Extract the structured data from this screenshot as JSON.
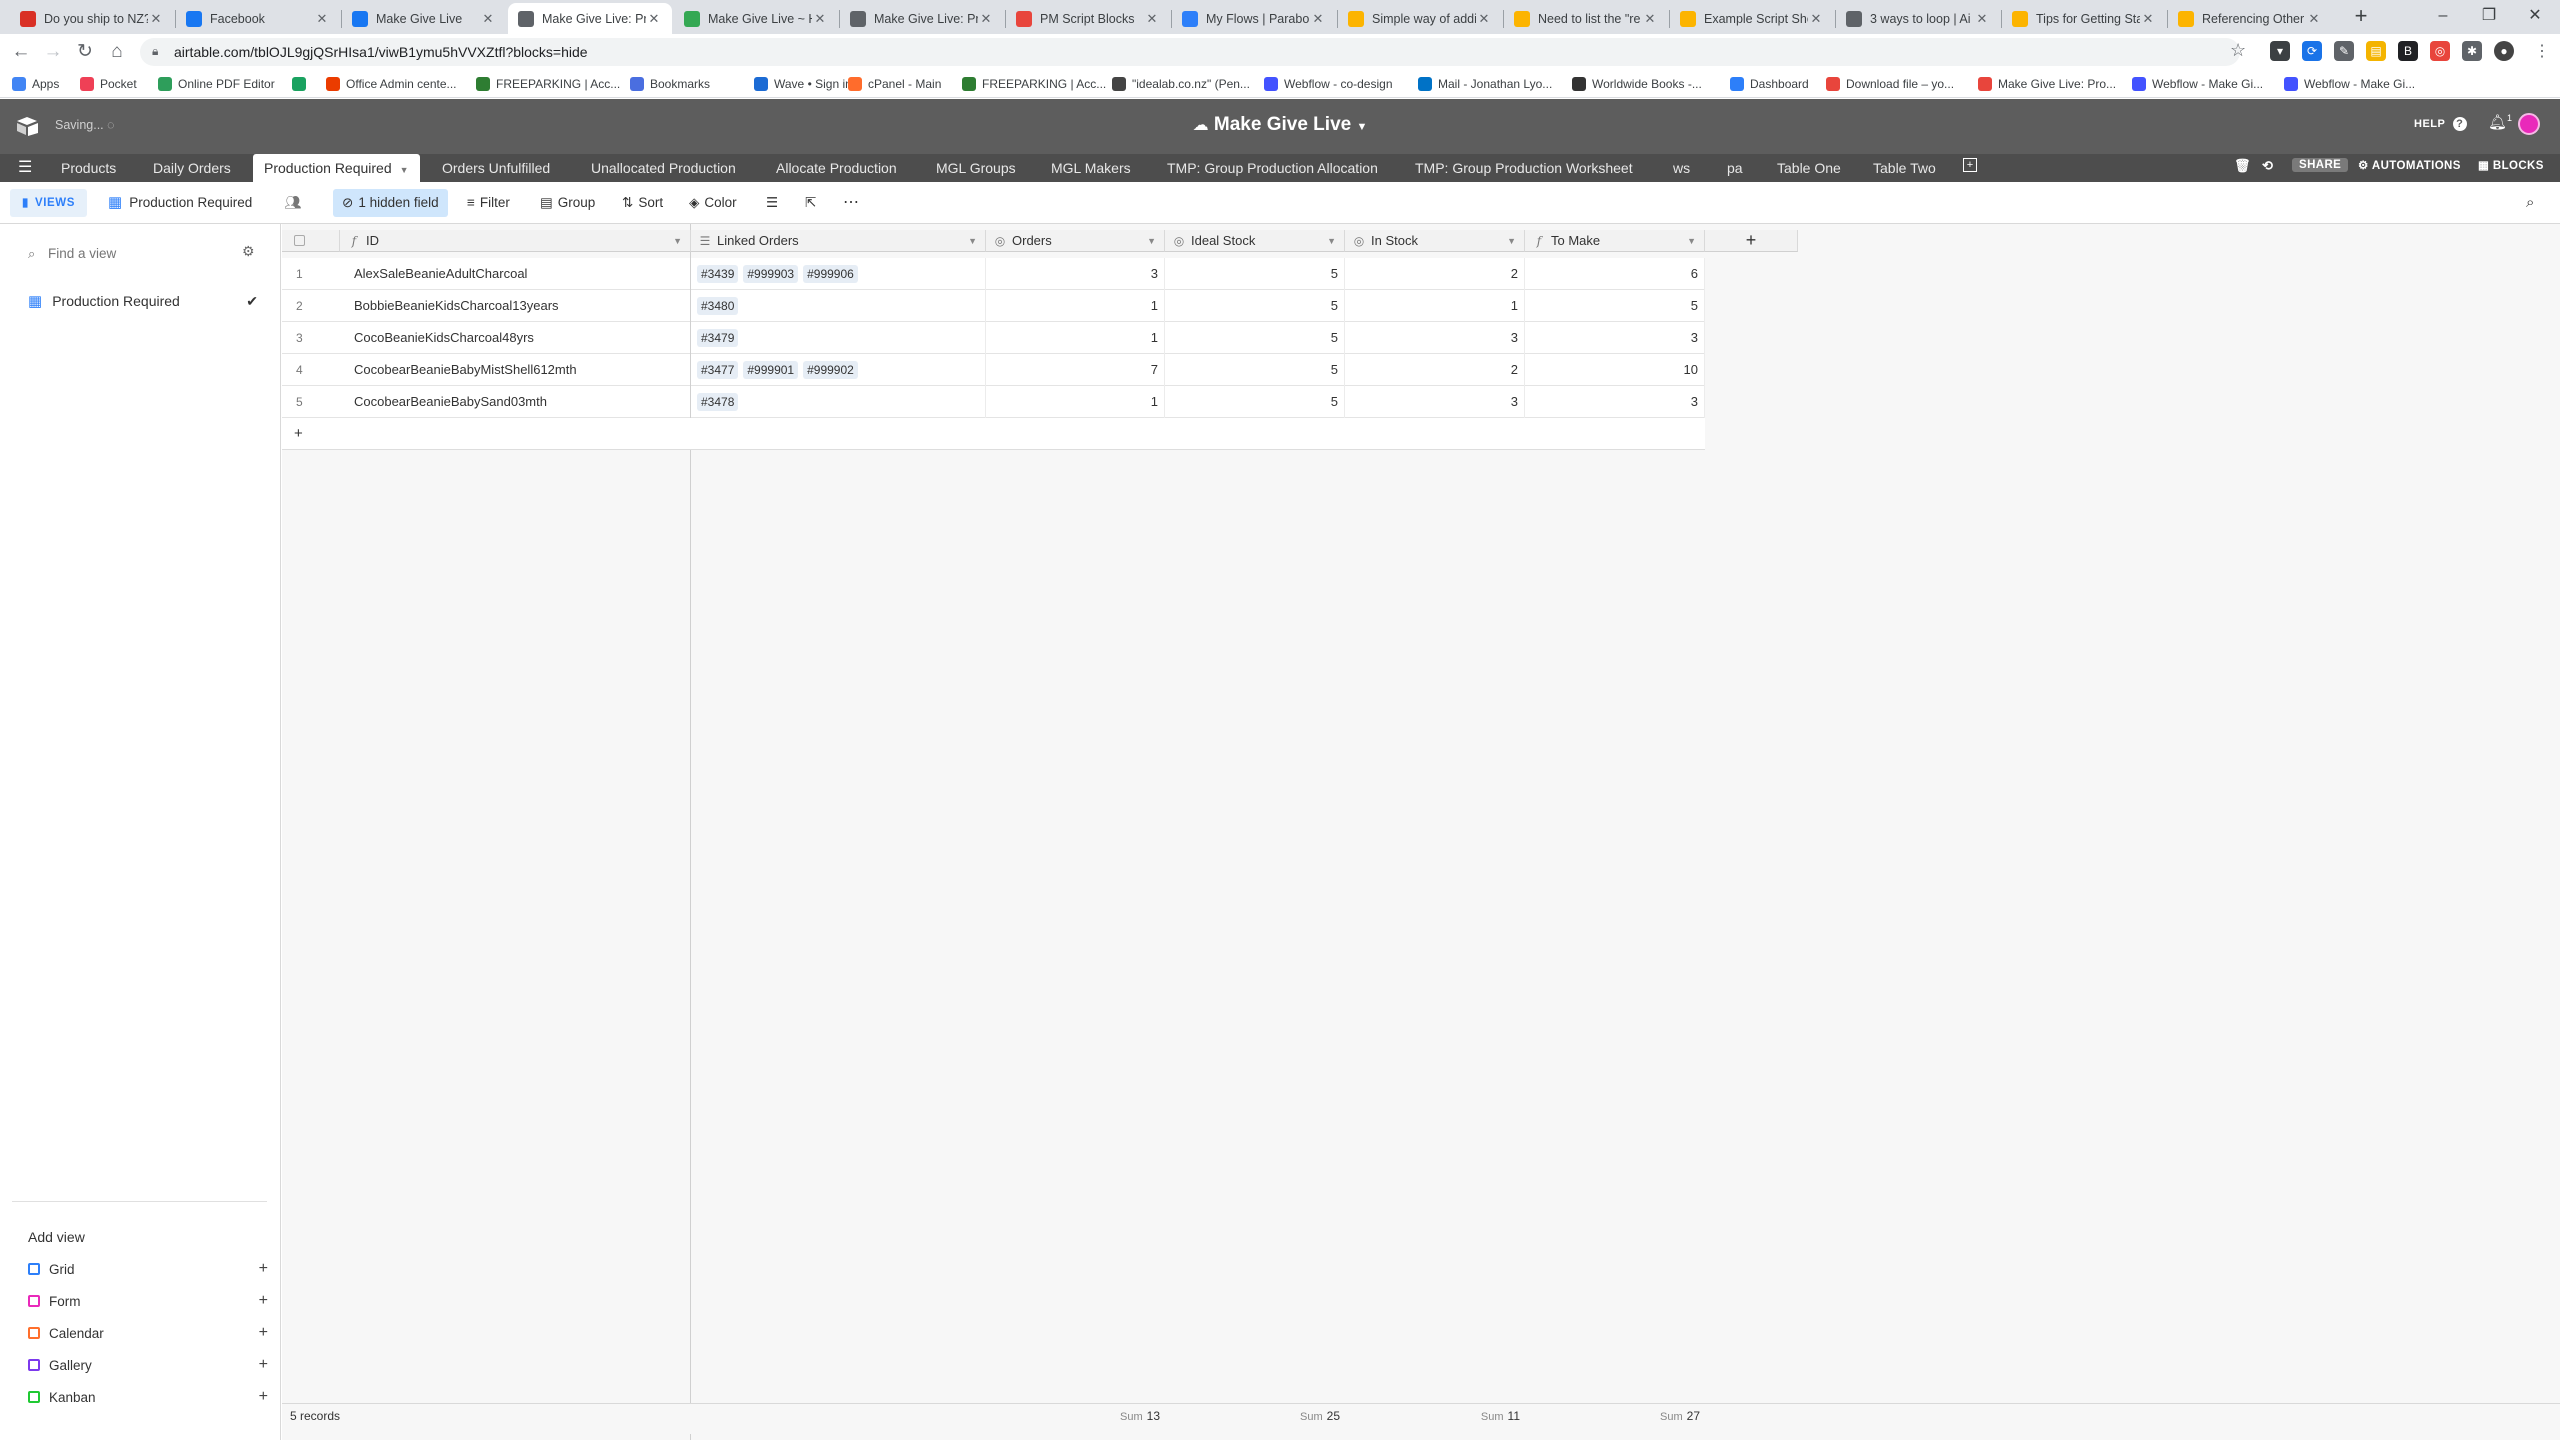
{
  "browser": {
    "tabs": [
      {
        "title": "Do you ship to NZ?",
        "favicon_color": "#d93025",
        "active": false
      },
      {
        "title": "Facebook",
        "favicon_color": "#1877f2",
        "active": false
      },
      {
        "title": "Make Give Live",
        "favicon_color": "#1877f2",
        "active": false
      },
      {
        "title": "Make Give Live: Production Required",
        "favicon_color": "#5f6368",
        "active": true
      },
      {
        "title": "Make Give Live ~ Home",
        "favicon_color": "#34a853",
        "active": false
      },
      {
        "title": "Make Give Live: Production",
        "favicon_color": "#5f6368",
        "active": false
      },
      {
        "title": "PM Script Blocks",
        "favicon_color": "#e8453c",
        "active": false
      },
      {
        "title": "My Flows | Parabola",
        "favicon_color": "#2d7ff9",
        "active": false
      },
      {
        "title": "Simple way of adding",
        "favicon_color": "#fcb400",
        "active": false
      },
      {
        "title": "Need to list the \"re",
        "favicon_color": "#fcb400",
        "active": false
      },
      {
        "title": "Example Script Sho",
        "favicon_color": "#fcb400",
        "active": false
      },
      {
        "title": "3 ways to loop | Ai",
        "favicon_color": "#5f6368",
        "active": false
      },
      {
        "title": "Tips for Getting Sta",
        "favicon_color": "#fcb400",
        "active": false
      },
      {
        "title": "Referencing Other",
        "favicon_color": "#fcb400",
        "active": false
      }
    ],
    "url": "airtable.com/tblOJL9gjQSrHIsa1/viwB1ymu5hVVXZtfl?blocks=hide",
    "bookmarks": [
      {
        "label": "Apps",
        "color": "#4285f4"
      },
      {
        "label": "Pocket",
        "color": "#ef4056"
      },
      {
        "label": "Online PDF Editor",
        "color": "#2e9e5b"
      },
      {
        "label": "",
        "color": "#1aa260"
      },
      {
        "label": "Office Admin cente...",
        "color": "#eb3c00"
      },
      {
        "label": "FREEPARKING | Acc...",
        "color": "#2e7d32"
      },
      {
        "label": "Bookmarks",
        "color": "#4a6ee0"
      },
      {
        "label": "Wave • Sign in",
        "color": "#1c6bd4"
      },
      {
        "label": "cPanel - Main",
        "color": "#ff6c2c"
      },
      {
        "label": "FREEPARKING | Acc...",
        "color": "#2e7d32"
      },
      {
        "label": "\"idealab.co.nz\" (Pen...",
        "color": "#444444"
      },
      {
        "label": "Webflow - co-design",
        "color": "#4353ff"
      },
      {
        "label": "Mail - Jonathan Lyo...",
        "color": "#0072c6"
      },
      {
        "label": "Worldwide Books -...",
        "color": "#333333"
      },
      {
        "label": "Dashboard",
        "color": "#2d7ff9"
      },
      {
        "label": "Download file – yo...",
        "color": "#e8453c"
      },
      {
        "label": "Make Give Live: Pro...",
        "color": "#e8453c"
      },
      {
        "label": "Webflow - Make Gi...",
        "color": "#4353ff"
      },
      {
        "label": "Webflow - Make Gi...",
        "color": "#4353ff"
      }
    ]
  },
  "header": {
    "saving": "Saving...",
    "base_name": "Make Give Live",
    "help": "HELP",
    "notification_count": "1"
  },
  "tables": [
    "Products",
    "Daily Orders",
    "Production Required",
    "Orders Unfulfilled",
    "Unallocated Production",
    "Allocate Production",
    "MGL Groups",
    "MGL Makers",
    "TMP: Group Production Allocation",
    "TMP: Group Production Worksheet",
    "ws",
    "pa",
    "Table One",
    "Table Two"
  ],
  "active_table": "Production Required",
  "table_actions": {
    "share": "SHARE",
    "automations": "AUTOMATIONS",
    "blocks": "BLOCKS"
  },
  "viewbar": {
    "views": "VIEWS",
    "view_name": "Production Required",
    "hidden": "1 hidden field",
    "filter": "Filter",
    "group": "Group",
    "sort": "Sort",
    "color": "Color"
  },
  "sidebar": {
    "find_placeholder": "Find a view",
    "views": [
      {
        "name": "Production Required",
        "selected": true
      }
    ],
    "add_view_title": "Add view",
    "add_view_types": [
      {
        "label": "Grid",
        "color": "#2d7ff9"
      },
      {
        "label": "Form",
        "color": "#e929ba"
      },
      {
        "label": "Calendar",
        "color": "#ff6f2c"
      },
      {
        "label": "Gallery",
        "color": "#7c39ed"
      },
      {
        "label": "Kanban",
        "color": "#20c933"
      }
    ]
  },
  "grid": {
    "columns": [
      "ID",
      "Linked Orders",
      "Orders",
      "Ideal Stock",
      "In Stock",
      "To Make"
    ],
    "rows": [
      {
        "n": "1",
        "id": "AlexSaleBeanieAdultCharcoal",
        "linked": [
          "#3439",
          "#999903",
          "#999906"
        ],
        "orders": "3",
        "ideal": "5",
        "instock": "2",
        "tomake": "6"
      },
      {
        "n": "2",
        "id": "BobbieBeanieKidsCharcoal13years",
        "linked": [
          "#3480"
        ],
        "orders": "1",
        "ideal": "5",
        "instock": "1",
        "tomake": "5"
      },
      {
        "n": "3",
        "id": "CocoBeanieKidsCharcoal48yrs",
        "linked": [
          "#3479"
        ],
        "orders": "1",
        "ideal": "5",
        "instock": "3",
        "tomake": "3"
      },
      {
        "n": "4",
        "id": "CocobearBeanieBabyMistShell612mth",
        "linked": [
          "#3477",
          "#999901",
          "#999902"
        ],
        "orders": "7",
        "ideal": "5",
        "instock": "2",
        "tomake": "10"
      },
      {
        "n": "5",
        "id": "CocobearBeanieBabySand03mth",
        "linked": [
          "#3478"
        ],
        "orders": "1",
        "ideal": "5",
        "instock": "3",
        "tomake": "3"
      }
    ],
    "record_count": "5 records",
    "sum_label": "Sum",
    "sums": {
      "orders": "13",
      "ideal": "25",
      "instock": "11",
      "tomake": "27"
    }
  }
}
